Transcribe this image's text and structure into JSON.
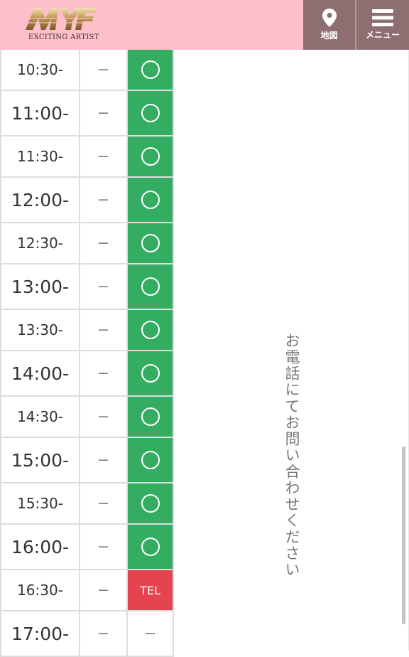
{
  "header": {
    "logo_mark": "MYF",
    "logo_tagline": "EXCITING  ARTIST",
    "map_label": "地図",
    "menu_label": "メニュー",
    "bg_color": "#fdbfcb",
    "button_color": "#8e6e71"
  },
  "schedule": {
    "rows": [
      {
        "time": "10:30-",
        "col2": "－",
        "status": "ok"
      },
      {
        "time": "11:00-",
        "col2": "－",
        "status": "ok"
      },
      {
        "time": "11:30-",
        "col2": "－",
        "status": "ok"
      },
      {
        "time": "12:00-",
        "col2": "－",
        "status": "ok"
      },
      {
        "time": "12:30-",
        "col2": "－",
        "status": "ok"
      },
      {
        "time": "13:00-",
        "col2": "－",
        "status": "ok"
      },
      {
        "time": "13:30-",
        "col2": "－",
        "status": "ok"
      },
      {
        "time": "14:00-",
        "col2": "－",
        "status": "ok"
      },
      {
        "time": "14:30-",
        "col2": "－",
        "status": "ok"
      },
      {
        "time": "15:00-",
        "col2": "－",
        "status": "ok"
      },
      {
        "time": "15:30-",
        "col2": "－",
        "status": "ok"
      },
      {
        "time": "16:00-",
        "col2": "－",
        "status": "ok"
      },
      {
        "time": "16:30-",
        "col2": "－",
        "status": "tel",
        "status_text": "TEL"
      },
      {
        "time": "17:00-",
        "col2": "－",
        "status": "none",
        "status_text": "－"
      }
    ],
    "available_color": "#34ad62",
    "tel_color": "#e5434e"
  },
  "notice": {
    "text": "お電話にてお問い合わせください"
  }
}
